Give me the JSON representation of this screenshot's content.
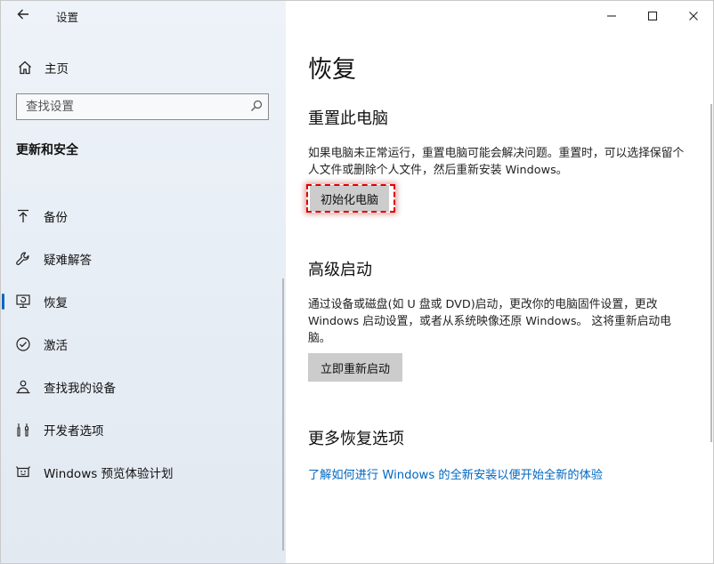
{
  "window": {
    "app_title": "设置"
  },
  "sidebar": {
    "home_label": "主页",
    "search_placeholder": "查找设置",
    "section_title": "更新和安全",
    "items": [
      {
        "label": "备份",
        "icon": "backup-arrow-icon"
      },
      {
        "label": "疑难解答",
        "icon": "wrench-icon"
      },
      {
        "label": "恢复",
        "icon": "recovery-icon",
        "active": true
      },
      {
        "label": "激活",
        "icon": "check-circle-icon"
      },
      {
        "label": "查找我的设备",
        "icon": "person-location-icon"
      },
      {
        "label": "开发者选项",
        "icon": "developer-tools-icon"
      },
      {
        "label": "Windows 预览体验计划",
        "icon": "insider-smiley-icon"
      }
    ]
  },
  "main": {
    "title": "恢复",
    "reset": {
      "heading": "重置此电脑",
      "description": "如果电脑未正常运行，重置电脑可能会解决问题。重置时，可以选择保留个人文件或删除个人文件，然后重新安装 Windows。",
      "button": "初始化电脑"
    },
    "advanced": {
      "heading": "高级启动",
      "description": "通过设备或磁盘(如 U 盘或 DVD)启动，更改你的电脑固件设置，更改 Windows 启动设置，或者从系统映像还原 Windows。 这将重新启动电脑。",
      "button": "立即重新启动"
    },
    "more": {
      "heading": "更多恢复选项",
      "link": "了解如何进行 Windows 的全新安装以便开始全新的体验"
    }
  },
  "colors": {
    "accent": "#0067c0",
    "highlight": "#e00000",
    "button_bg": "#cccccc"
  }
}
